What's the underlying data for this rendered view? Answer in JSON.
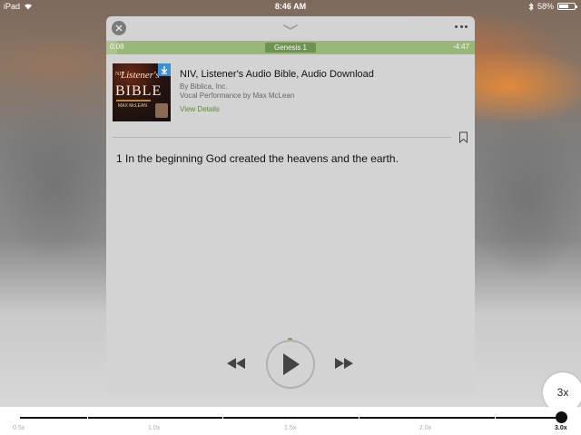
{
  "status_bar": {
    "device": "iPad",
    "time": "8:46 AM",
    "battery": "58%",
    "battery_level": 0.58
  },
  "player": {
    "elapsed": "0:08",
    "remaining": "-4:47",
    "chapter": "Genesis 1",
    "progress": 0.03,
    "item": {
      "title": "NIV, Listener's Audio Bible, Audio Download",
      "publisher": "By Biblica, Inc.",
      "narration": "Vocal Performance by Max McLean",
      "view_details": "View Details",
      "cover": {
        "niv": "NIV",
        "listener": "Listener's",
        "bible": "BIBLE",
        "narrator": "MAX McLEAN"
      }
    },
    "verse": "1 In the beginning God created the heavens and the earth."
  },
  "speed": {
    "current": "3x",
    "labels": [
      "0.5x",
      "1.0x",
      "1.5x",
      "2.0x",
      "3.0x"
    ],
    "selected_index": 4
  },
  "icons": {
    "close": "close-icon",
    "collapse": "chevron-down-icon",
    "more": "more-icon",
    "bookmark": "bookmark-icon",
    "download": "download-icon",
    "rewind": "rewind-icon",
    "play": "play-icon",
    "forward": "fast-forward-icon"
  },
  "colors": {
    "progress_bg": "#9ab77a",
    "chapter_pill": "#6e9451",
    "link_green": "#5e8a3c",
    "download_blue": "#3d8fd4"
  }
}
